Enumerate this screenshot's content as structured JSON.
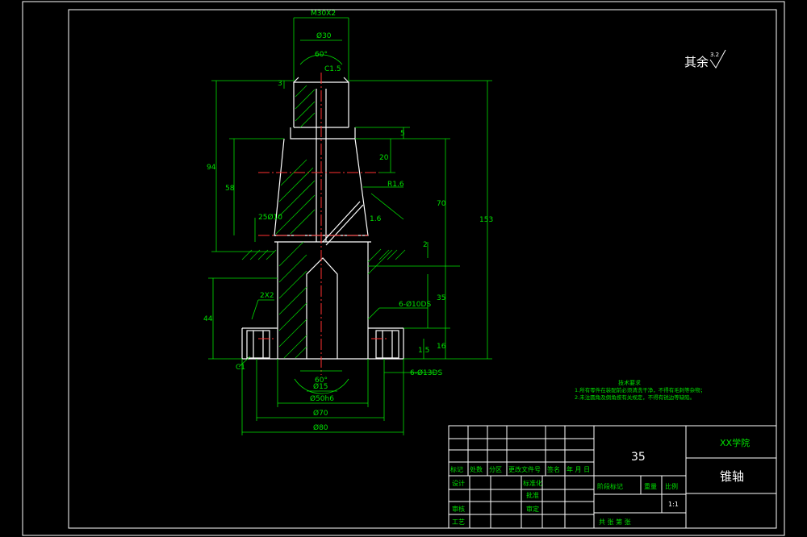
{
  "drawing": {
    "surface_finish_label": "其余",
    "surface_finish_value": "3.2",
    "notes_title": "技术要求",
    "notes": [
      "1.所有零件在装配前必须清洗干净，不得有毛刺等杂物；",
      "2.未注圆角及倒角按有关规定，不得有锐边等缺陷。"
    ],
    "dimensions": {
      "thread_top": "M30X2",
      "d_top": "Ø30",
      "angle_top": "60°",
      "c_top": "C1.5",
      "d_3": "3",
      "d_5": "5",
      "d_20": "20",
      "r16": "R1.6",
      "d_1_6": "1.6",
      "d_70": "70",
      "d_94": "94",
      "d_58": "58",
      "cone": "25Ø10",
      "d_153": "153",
      "d_2": "2",
      "d_35": "35",
      "d_44": "44",
      "d_1_2x": "2X2",
      "holes_a": "6-Ø10DS",
      "holes_b": "6-Ø13DS",
      "d_16": "16",
      "d_1_5": "1.5",
      "c_bottom": "C1",
      "angle_bottom": "60°",
      "d_ø15": "Ø15",
      "d_ø50": "Ø50h6",
      "d_ø70": "Ø70",
      "d_ø80": "Ø80"
    }
  },
  "title_block": {
    "part_number": "35",
    "school": "XX学院",
    "part_name": "锥轴",
    "rev_headers": [
      "标记",
      "处数",
      "分区",
      "更改文件号",
      "签名",
      "年 月 日"
    ],
    "rows_left": [
      "设计",
      "审核",
      "工艺"
    ],
    "rows_mid": [
      "标准化",
      "批准"
    ],
    "mid_extra": "审定",
    "stage_label": "阶段标记",
    "weight_label": "重量",
    "scale_label": "比例",
    "scale_value": "1:1",
    "sheets_label": "共 张 第 张"
  }
}
